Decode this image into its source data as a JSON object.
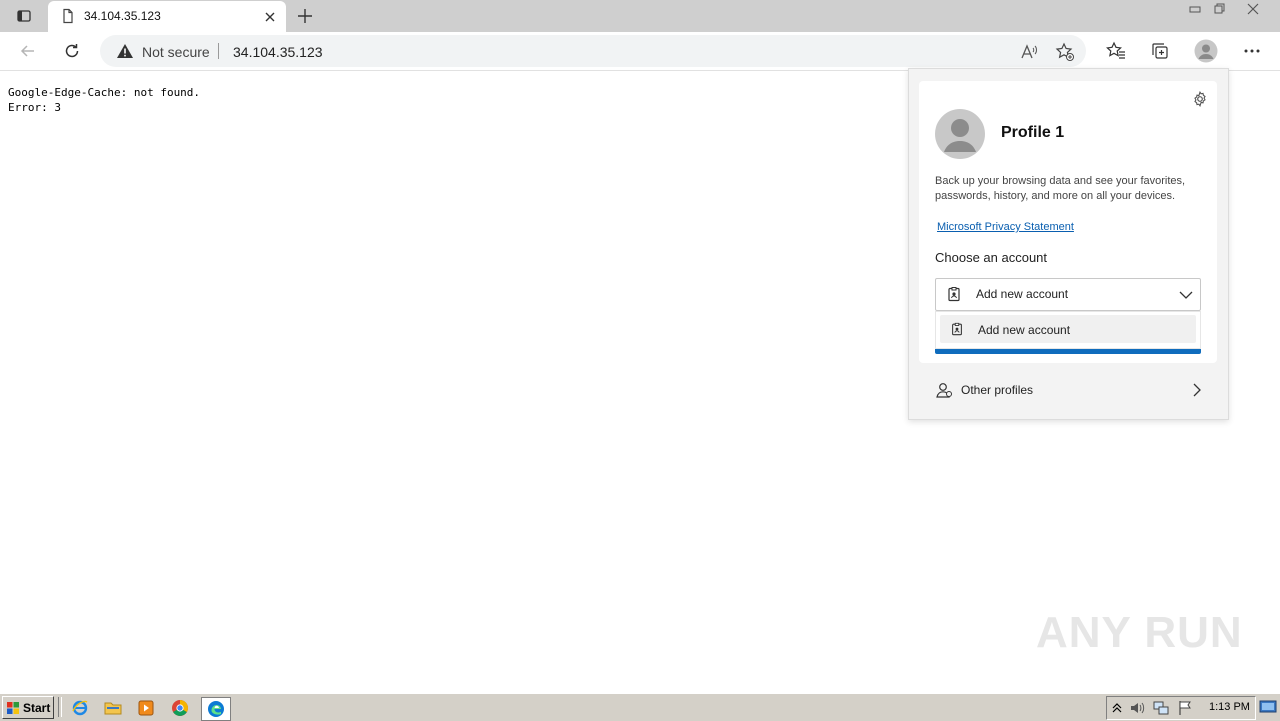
{
  "tab": {
    "title": "34.104.35.123"
  },
  "toolbar": {
    "security_label": "Not secure",
    "url": "34.104.35.123"
  },
  "page": {
    "line1": "Google-Edge-Cache: not found.",
    "line2": "Error: 3"
  },
  "profile_flyout": {
    "profile_name": "Profile 1",
    "description": "Back up your browsing data and see your favorites, passwords, history, and more on all your devices.",
    "privacy_link": "Microsoft Privacy Statement",
    "choose_heading": "Choose an account",
    "account_select_value": "Add new account",
    "account_options": [
      "Add new account"
    ],
    "other_profiles_label": "Other profiles",
    "accent_color": "#0f6cbd"
  },
  "watermark": {
    "text": "ANY RUN"
  },
  "taskbar": {
    "start_label": "Start",
    "clock": "1:13 PM"
  }
}
